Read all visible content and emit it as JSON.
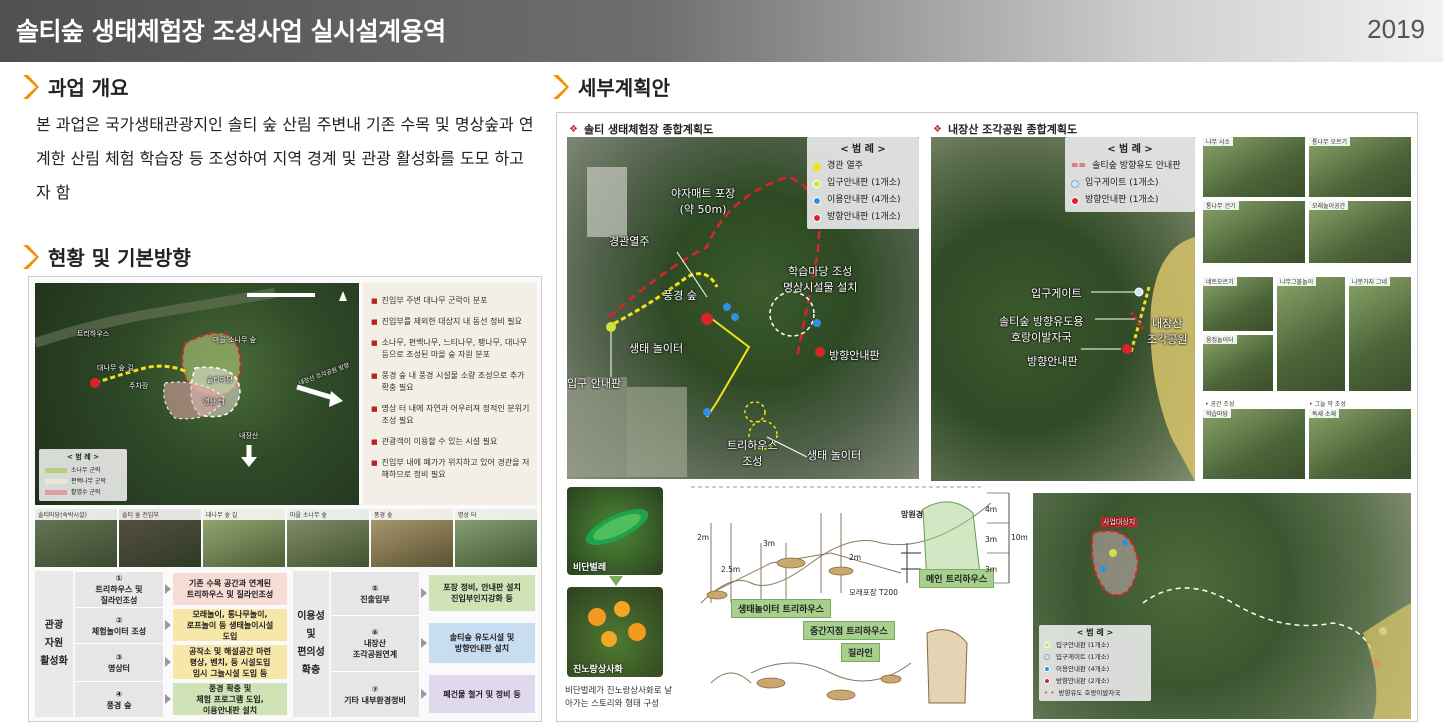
{
  "header": {
    "title": "솔티숲 생태체험장 조성사업 실시설계용역",
    "year": "2019"
  },
  "sections": {
    "overview_title": "과업 개요",
    "overview_text": "본 과업은 국가생태관광지인 솔티 숲 산림 주변내 기존 수목 및 명상숲과 연계한 산림 체험 학습장 등 조성하여 지역 경계 및 관광 활성화를 도모 하고자 함",
    "status_title": "현황 및 기본방향",
    "detail_title": "세부계획안"
  },
  "left_map": {
    "legend_title": "< 범 례 >",
    "legend_items": [
      "소나무 군락",
      "편백나무 군락",
      "활엽수 군락"
    ],
    "labels": [
      "대나무 숲 길",
      "주차장",
      "트리하우스",
      "마을 소나무 숲",
      "내장산",
      "솔티마당",
      "명상 터"
    ],
    "direction": "내장산 조각공원 방향"
  },
  "issues": [
    "진입부 주변 대나무 군락이 분포",
    "진입부를 제외한 대상지 내 동선 정비 필요",
    "소나무, 편백나무, 느티나무, 팽나무, 대나무 등으로 조성된 마을 숲 자원 분포",
    "풍경 숲 내 풍경 시설물 소량 조성으로 추가 확충 필요",
    "명상 터 내에 자연과 어우러져 정적인 분위기 조성 필요",
    "관광객이 이용할 수 있는 시설 필요",
    "진입부 내에 폐가가 위치하고 있어 경관을 저해하므로 정비 필요"
  ],
  "photo_strip": [
    "솔티마당(숙박시설)",
    "솔티 숲 진입부",
    "대나무 숲 길",
    "마을 소나무 숲",
    "풍경 숲",
    "명상 터"
  ],
  "flow": {
    "cat_left": "관광\n자원\n활성화",
    "cat_mid": "이용성\n및\n편의성\n확충",
    "left_steps": [
      {
        "num": "①",
        "label": "트리하우스 및\n질라인조성",
        "result": "기존 수목 공간과 연계된\n트리하우스 및 질라인조성"
      },
      {
        "num": "②",
        "label": "체험놀이터 조성",
        "result": "모래놀이, 통나무놀이,\n로프놀이 등 생태놀이시설\n도입"
      },
      {
        "num": "③",
        "label": "명상터",
        "result": "공작소 및 해설공간 마련\n평상, 벤치, 등 시설도입\n임시 그늘시설 도입 등"
      },
      {
        "num": "④",
        "label": "풍경 숲",
        "result": "풍경 확충 및\n체험 프로그램 도입,\n이용안내판 설치"
      }
    ],
    "right_steps": [
      {
        "num": "⑤",
        "label": "진출입부",
        "result": "포장 정비, 안내판 설치\n진입부인지강화 등"
      },
      {
        "num": "⑥",
        "label": "내장산\n조각공원연계",
        "result": "솔티숲 유도시설 및\n방향안내판 설치"
      },
      {
        "num": "⑦",
        "label": "기타 내부환경정비",
        "result": "폐건물 철거 및 정비 등"
      }
    ]
  },
  "plan1": {
    "title": "솔티 생태체험장 종합계획도",
    "legend_title": "< 범 례 >",
    "legend": [
      {
        "label": "경관 열주",
        "color": "#f5e11a"
      },
      {
        "label": "입구안내판 (1개소)",
        "color": "#c8e63c"
      },
      {
        "label": "이용안내판 (4개소)",
        "color": "#2f8fe0"
      },
      {
        "label": "방향안내판 (1개소)",
        "color": "#d8242a"
      }
    ],
    "labels": {
      "mat": "야자매트 포장\n(약 50m)",
      "col": "경관열주",
      "scenery": "풍경 숲",
      "play": "생태 놀이터",
      "study": "학습마당 조성\n명상시설물 설치",
      "dir": "방향안내판",
      "entry": "입구 안내판",
      "tree": "트리하우스\n조성",
      "play2": "생태 놀이터"
    }
  },
  "plan2": {
    "title": "내장산 조각공원 종합계획도",
    "legend_title": "< 범 례 >",
    "legend": [
      {
        "label": "솔티숲 방향유도 안내판",
        "color": "#d8242a"
      },
      {
        "label": "입구게이트 (1개소)",
        "color": "#cfe6f5"
      },
      {
        "label": "방향안내판 (1개소)",
        "color": "#d8242a"
      }
    ],
    "labels": {
      "gate": "입구게이트",
      "guide": "솔티숲 방향유도용\n호랑이발자국",
      "dir": "방향안내판",
      "park": "내장산\n조각공원"
    }
  },
  "photos": {
    "top": [
      "나무 시소",
      "통나무 오르기",
      "통나무 건기",
      "모래놀이공간",
      "네트오르기",
      "나무그물놀이",
      "나뭇가지 그네",
      "움집놀이터"
    ],
    "sec1": "• 공간 조성",
    "sec2": "• 그늘 막 조성",
    "bottom": [
      "학습마당",
      "독새 소재"
    ]
  },
  "insect": {
    "beetle": "비단벌레",
    "flower": "진노랑상사화",
    "note": "비단벌레가 진노랑상사화로 날아가는 스토리와 형태 구성"
  },
  "sketch": {
    "tags": [
      "생태놀이터 트리하우스",
      "중간지점 트리하우스",
      "질라인",
      "메인 트리하우스",
      "망원경"
    ],
    "dims": [
      "2m",
      "2.5m",
      "3m",
      "2m",
      "4m",
      "3m",
      "3m",
      "10m",
      "모래포장 T200"
    ]
  },
  "map3": {
    "legend_title": "< 범 례 >",
    "legend": [
      {
        "label": "입구안내판 (1개소)",
        "color": "#c8e63c"
      },
      {
        "label": "입구게이트 (1개소)",
        "color": "#cfe6f5"
      },
      {
        "label": "이용안내판 (4개소)",
        "color": "#2f8fe0"
      },
      {
        "label": "방향안내판 (2개소)",
        "color": "#d8242a"
      },
      {
        "label": "방향유도 호랑이발자국",
        "color": "#e05a2a"
      }
    ],
    "site_label": "사업대상지"
  }
}
